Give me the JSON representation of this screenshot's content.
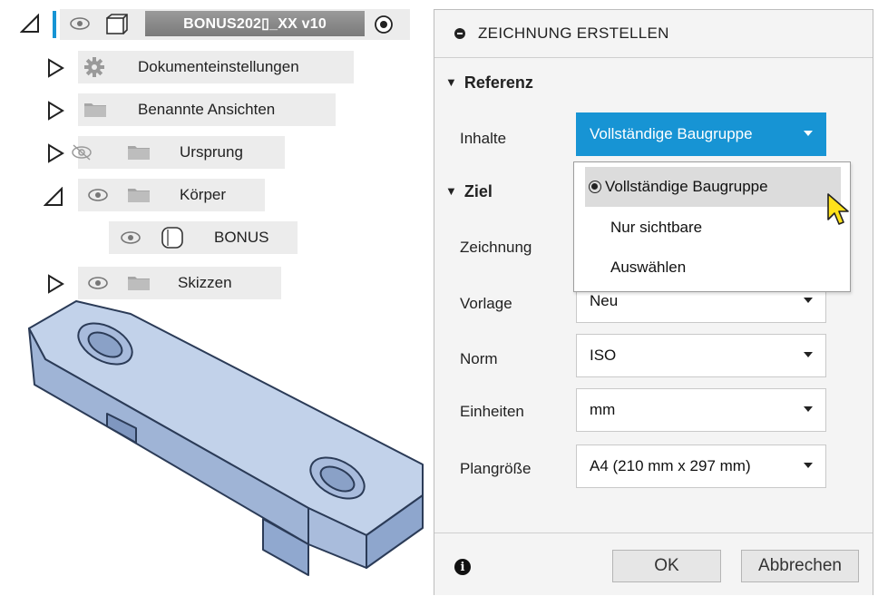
{
  "browser": {
    "root": {
      "label": "BONUS202▯_XX v10"
    },
    "items": [
      {
        "label": "Dokumenteinstellungen"
      },
      {
        "label": "Benannte Ansichten"
      },
      {
        "label": "Ursprung"
      },
      {
        "label": "Körper"
      },
      {
        "label": "BONUS"
      },
      {
        "label": "Skizzen"
      }
    ]
  },
  "dialog": {
    "title": "ZEICHNUNG ERSTELLEN",
    "section_reference": "Referenz",
    "section_target": "Ziel",
    "fields": {
      "inhalte": {
        "label": "Inhalte",
        "value": "Vollständige Baugruppe"
      },
      "zeichnung": {
        "label": "Zeichnung"
      },
      "vorlage": {
        "label": "Vorlage",
        "value": "Neu"
      },
      "norm": {
        "label": "Norm",
        "value": "ISO"
      },
      "einheiten": {
        "label": "Einheiten",
        "value": "mm"
      },
      "plangroesse": {
        "label": "Plangröße",
        "value": "A4 (210 mm x 297 mm)"
      }
    },
    "dropdown_options": [
      {
        "label": "Vollständige Baugruppe",
        "selected": true
      },
      {
        "label": "Nur sichtbare",
        "selected": false
      },
      {
        "label": "Auswählen",
        "selected": false
      }
    ],
    "buttons": {
      "ok": "OK",
      "cancel": "Abbrechen"
    }
  },
  "colors": {
    "accent": "#1794d4",
    "model_fill": "#b4c6e2",
    "model_edge": "#2b3b57"
  }
}
